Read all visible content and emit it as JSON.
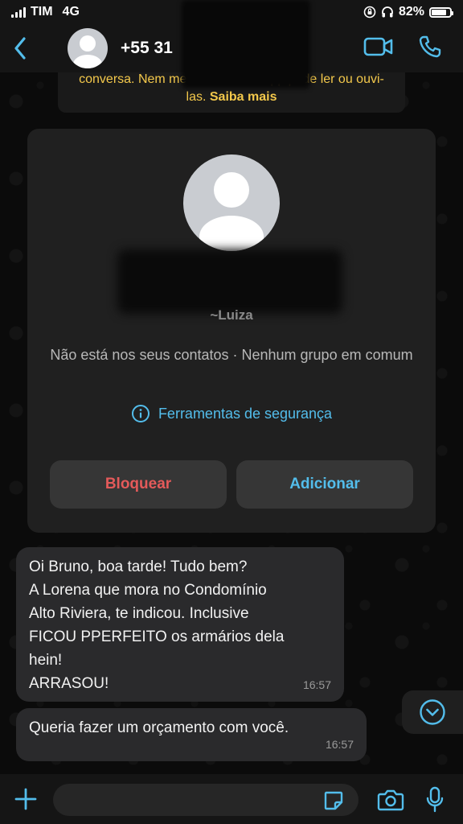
{
  "status_bar": {
    "carrier": "TIM",
    "network": "4G",
    "battery": "82%",
    "battery_level": 0.82
  },
  "header": {
    "contact_number_prefix": "+55 31"
  },
  "encryption_notice": {
    "text": "conversa. Nem mesmo o WhatsApp pode ler ou ouvi-las.",
    "link": "Saiba mais"
  },
  "contact_card": {
    "push_name": "~Luiza",
    "not_in_contacts": "Não está nos seus contatos · Nenhum grupo em comum",
    "security_tools": "Ferramentas de segurança",
    "block_label": "Bloquear",
    "add_label": "Adicionar"
  },
  "messages": [
    {
      "lines": [
        "Oi Bruno, boa tarde! Tudo bem?",
        "A Lorena que mora no Condomínio",
        "Alto Riviera, te indicou. Inclusive",
        "FICOU PPERFEITO os armários dela",
        "hein!",
        "ARRASOU!"
      ],
      "time": "16:57"
    },
    {
      "text": "Queria fazer um orçamento com você.",
      "time": "16:57"
    }
  ],
  "input": {
    "placeholder": ""
  },
  "colors": {
    "accent_blue": "#53bdeb",
    "block_red": "#e45a5a",
    "notice_yellow": "#f3c84b",
    "bubble": "#2a2a2c"
  },
  "icons": {
    "back": "chevron-left-icon",
    "video": "video-camera-icon",
    "call": "phone-icon",
    "info": "info-circle-icon",
    "scroll": "chevron-down-circle-icon",
    "plus": "plus-icon",
    "sticker": "sticker-icon",
    "camera": "camera-icon",
    "mic": "microphone-icon"
  }
}
